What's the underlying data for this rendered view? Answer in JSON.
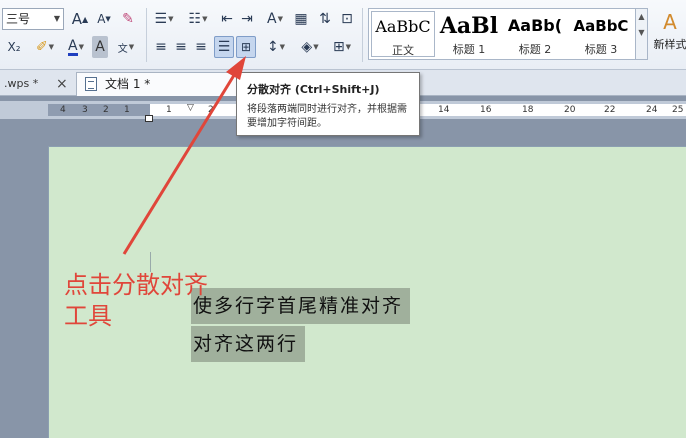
{
  "ribbon": {
    "font_size": "三号",
    "grow_font_icon": "A",
    "shrink_font_icon": "A",
    "style_gallery": [
      {
        "sample": "AaBbC",
        "caption": "正文"
      },
      {
        "sample": "AaBl",
        "caption": "标题 1"
      },
      {
        "sample": "AaBb(",
        "caption": "标题 2"
      },
      {
        "sample": "AaBbC",
        "caption": "标题 3"
      }
    ],
    "new_style_label": "新样式"
  },
  "tabs": [
    {
      "label": ".wps *"
    },
    {
      "label": "文档 1 *"
    }
  ],
  "tab_close_glyph": "×",
  "ruler": {
    "left_numbers": [
      "4",
      "3",
      "2",
      "1"
    ],
    "right_numbers": [
      "1",
      "2",
      "14",
      "16",
      "18",
      "20",
      "22",
      "24",
      "25"
    ]
  },
  "tooltip": {
    "title": "分散对齐 (Ctrl+Shift+J)",
    "description": "将段落两端同时进行对齐，并根据需要增加字符间距。"
  },
  "document": {
    "line_1": "使多行字首尾精准对齐",
    "line_2": "对齐这两行"
  },
  "annotation": {
    "line_1": "点击分散对齐",
    "line_2": "工具",
    "color": "#e0463a"
  },
  "colors": {
    "page_background": "#d1e8cd",
    "selection_highlight": "#a0b09c",
    "pressed_button": "#c5d6ee"
  }
}
